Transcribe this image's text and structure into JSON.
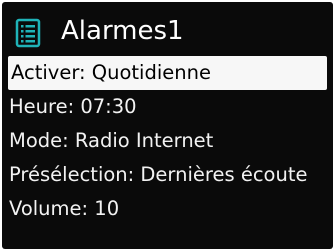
{
  "header": {
    "title": "Alarmes1",
    "icon": "list-icon",
    "accent": "#1fb3b8"
  },
  "menu": {
    "items": [
      {
        "label": "Activer: Quotidienne",
        "selected": true
      },
      {
        "label": "Heure: 07:30",
        "selected": false
      },
      {
        "label": "Mode: Radio Internet",
        "selected": false
      },
      {
        "label": "Présélection: Dernières écoute",
        "selected": false
      },
      {
        "label": "Volume: 10",
        "selected": false
      }
    ]
  },
  "colors": {
    "screen_background": "#0a0a0a",
    "text": "#f2f2f2",
    "selection_background": "#f7f7f7",
    "selection_text": "#000000"
  }
}
